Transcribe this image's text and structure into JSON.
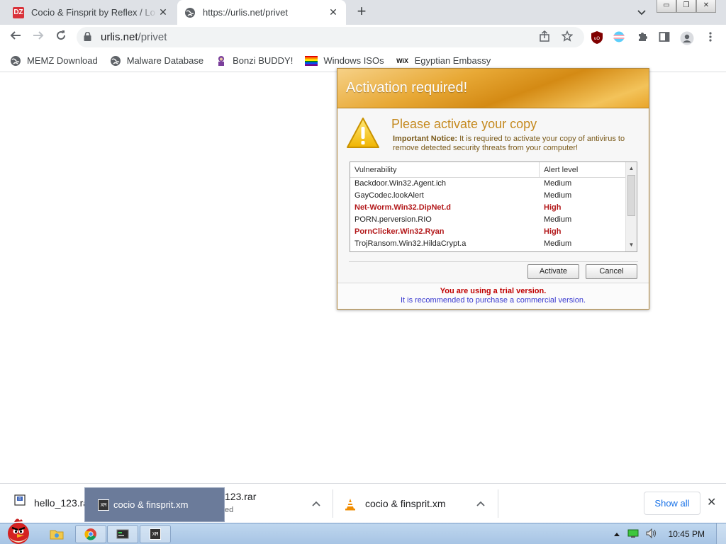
{
  "browser": {
    "tabs": [
      {
        "title": "Cocio & Finsprit by Reflex / Lo",
        "favicon_text": "DZ",
        "close": "✕"
      },
      {
        "title": "https://urlis.net/privet",
        "close": "✕"
      }
    ],
    "new_tab": "+",
    "tab_search": "⌄",
    "window_buttons": {
      "minimize": "▭",
      "restore": "❐",
      "close": "✕"
    },
    "address": {
      "domain": "urlis.net",
      "path": "/privet"
    },
    "bookmarks": [
      {
        "label": "MEMZ Download",
        "icon": "globe-icon"
      },
      {
        "label": "Malware Database",
        "icon": "globe-icon"
      },
      {
        "label": "Bonzi BUDDY!",
        "icon": "bonzi-icon"
      },
      {
        "label": "Windows ISOs",
        "icon": "rainbow-flag-icon"
      },
      {
        "label": "Egyptian Embassy",
        "icon": "wix-icon",
        "icon_text": "WiX"
      }
    ]
  },
  "dialog": {
    "title": "Activation required!",
    "subtitle": "Please activate your copy",
    "notice_label": "Important Notice:",
    "notice_text": " It is required to activate your copy of antivirus to remove detected security threats from your computer!",
    "columns": [
      "Vulnerability",
      "Alert level"
    ],
    "rows": [
      {
        "name": "Backdoor.Win32.Agent.ich",
        "level": "Medium",
        "high": false
      },
      {
        "name": "GayCodec.lookAlert",
        "level": "Medium",
        "high": false
      },
      {
        "name": "Net-Worm.Win32.DipNet.d",
        "level": "High",
        "high": true
      },
      {
        "name": "PORN.perversion.RIO",
        "level": "Medium",
        "high": false
      },
      {
        "name": "PornClicker.Win32.Ryan",
        "level": "High",
        "high": true
      },
      {
        "name": "TrojRansom.Win32.HildaCrypt.a",
        "level": "Medium",
        "high": false
      }
    ],
    "activate_label": "Activate",
    "cancel_label": "Cancel",
    "footer_trial": "You are using a trial version.",
    "footer_recommend": "It is recommended to purchase a commercial version."
  },
  "downloads": {
    "items": [
      {
        "name": "hello_123.rar",
        "sub": "ed"
      },
      {
        "name": "cocio & finsprit.xm"
      }
    ],
    "partial_name": "123.rar",
    "drag_ghost_label": "cocio & finsprit.xm",
    "xm_icon_text": "XM",
    "show_all": "Show all",
    "close": "✕"
  },
  "taskbar": {
    "time": "10:45 PM"
  },
  "colors": {
    "dialog_accent": "#e8a936",
    "alert_high": "#b3191b",
    "link_blue": "#3a3ad0",
    "chrome_blue": "#1a73e8"
  }
}
